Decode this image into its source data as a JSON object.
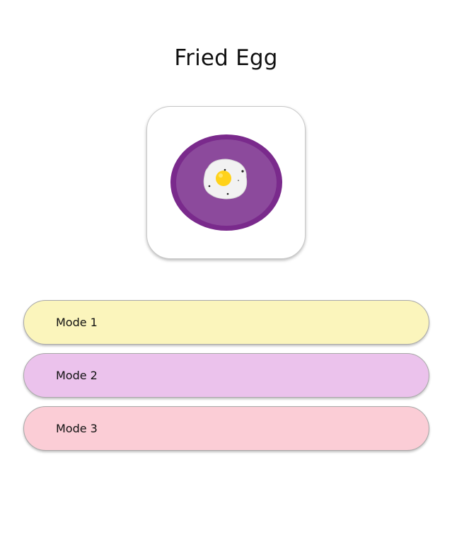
{
  "app": {
    "title": "Fried Egg"
  },
  "icon": {
    "name": "fried-egg-plate-icon",
    "plate_color": "#7a2a8c",
    "plate_inner_color": "#8c4a9c",
    "egg_white_color": "#f2f2f2",
    "yolk_color": "#ffd21a"
  },
  "modes": [
    {
      "label": "Mode 1",
      "color": "#fbf5bc"
    },
    {
      "label": "Mode 2",
      "color": "#ebc2ec"
    },
    {
      "label": "Mode 3",
      "color": "#fbcdd6"
    }
  ]
}
